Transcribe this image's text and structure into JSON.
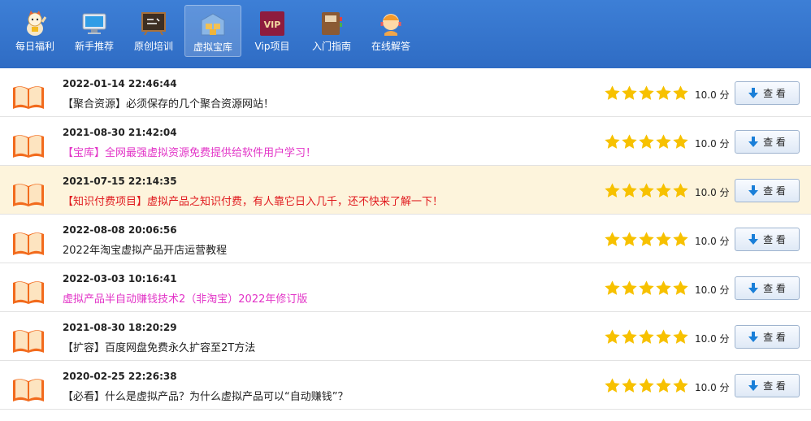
{
  "nav": {
    "items": [
      {
        "label": "每日福利",
        "icon": "lucky-cat-icon"
      },
      {
        "label": "新手推荐",
        "icon": "monitor-icon"
      },
      {
        "label": "原创培训",
        "icon": "blackboard-icon"
      },
      {
        "label": "虚拟宝库",
        "icon": "warehouse-icon"
      },
      {
        "label": "Vip项目",
        "icon": "vip-icon"
      },
      {
        "label": "入门指南",
        "icon": "guide-book-icon"
      },
      {
        "label": "在线解答",
        "icon": "support-agent-icon"
      }
    ],
    "active_index": 3
  },
  "rows": [
    {
      "date": "2022-01-14 22:46:44",
      "title": "【聚合资源】必须保存的几个聚合资源网站！",
      "score": "10.0 分",
      "button": "查 看",
      "rating": 5
    },
    {
      "date": "2021-08-30 21:42:04",
      "title": "【宝库】全网最强虚拟资源免费提供给软件用户学习！",
      "score": "10.0 分",
      "button": "查 看",
      "rating": 5
    },
    {
      "date": "2021-07-15 22:14:35",
      "title": "【知识付费项目】虚拟产品之知识付费，有人靠它日入几千，还不快来了解一下！",
      "score": "10.0 分",
      "button": "查 看",
      "rating": 5
    },
    {
      "date": "2022-08-08 20:06:56",
      "title": "2022年淘宝虚拟产品开店运营教程",
      "score": "10.0 分",
      "button": "查 看",
      "rating": 5
    },
    {
      "date": "2022-03-03 10:16:41",
      "title": "虚拟产品半自动赚钱技术2（非淘宝）2022年修订版",
      "score": "10.0 分",
      "button": "查 看",
      "rating": 5
    },
    {
      "date": "2021-08-30 18:20:29",
      "title": "【扩容】百度网盘免费永久扩容至2T方法",
      "score": "10.0 分",
      "button": "查 看",
      "rating": 5
    },
    {
      "date": "2020-02-25 22:26:38",
      "title": "【必看】什么是虚拟产品？为什么虚拟产品可以“自动赚钱”？",
      "score": "10.0 分",
      "button": "查 看",
      "rating": 5
    }
  ],
  "colors": {
    "nav_bg": "#3575cc",
    "pink_title": "#e234c7",
    "red_title": "#e0181d",
    "highlight_row": "#fdf4dc",
    "star": "#f7c100"
  }
}
